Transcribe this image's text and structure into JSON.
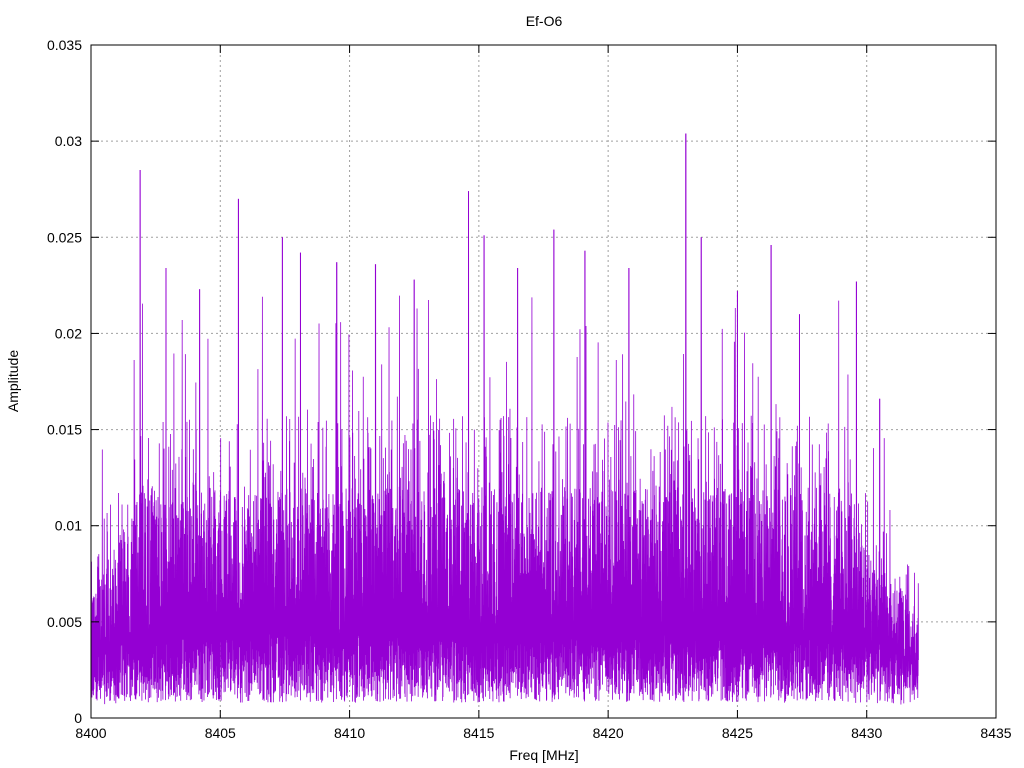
{
  "chart_data": {
    "type": "line",
    "title": "Ef-O6",
    "xlabel": "Freq [MHz]",
    "ylabel": "Amplitude",
    "xlim": [
      8400,
      8435
    ],
    "ylim": [
      0,
      0.035
    ],
    "x_ticks": [
      "8400",
      "8405",
      "8410",
      "8415",
      "8420",
      "8425",
      "8430",
      "8435"
    ],
    "y_ticks": [
      "0",
      "0.005",
      "0.01",
      "0.015",
      "0.02",
      "0.025",
      "0.03",
      "0.035"
    ],
    "grid": true,
    "legend": "none",
    "series_color": "#9400d3",
    "signal_range_mhz": [
      8400,
      8432
    ],
    "typical_amplitude_band": [
      0.004,
      0.012
    ],
    "notable_peaks": [
      {
        "x": 8401.9,
        "y": 0.0285
      },
      {
        "x": 8402.9,
        "y": 0.0234
      },
      {
        "x": 8404.2,
        "y": 0.0223
      },
      {
        "x": 8405.7,
        "y": 0.027
      },
      {
        "x": 8407.4,
        "y": 0.025
      },
      {
        "x": 8408.1,
        "y": 0.0242
      },
      {
        "x": 8409.5,
        "y": 0.0237
      },
      {
        "x": 8411.0,
        "y": 0.0236
      },
      {
        "x": 8412.5,
        "y": 0.0228
      },
      {
        "x": 8414.6,
        "y": 0.0274
      },
      {
        "x": 8415.2,
        "y": 0.0251
      },
      {
        "x": 8416.5,
        "y": 0.0234
      },
      {
        "x": 8417.9,
        "y": 0.0254
      },
      {
        "x": 8419.1,
        "y": 0.0243
      },
      {
        "x": 8420.8,
        "y": 0.0234
      },
      {
        "x": 8423.0,
        "y": 0.0304
      },
      {
        "x": 8423.6,
        "y": 0.025
      },
      {
        "x": 8425.0,
        "y": 0.0222
      },
      {
        "x": 8426.3,
        "y": 0.0246
      },
      {
        "x": 8427.4,
        "y": 0.021
      },
      {
        "x": 8429.6,
        "y": 0.0227
      },
      {
        "x": 8430.5,
        "y": 0.0166
      }
    ]
  }
}
